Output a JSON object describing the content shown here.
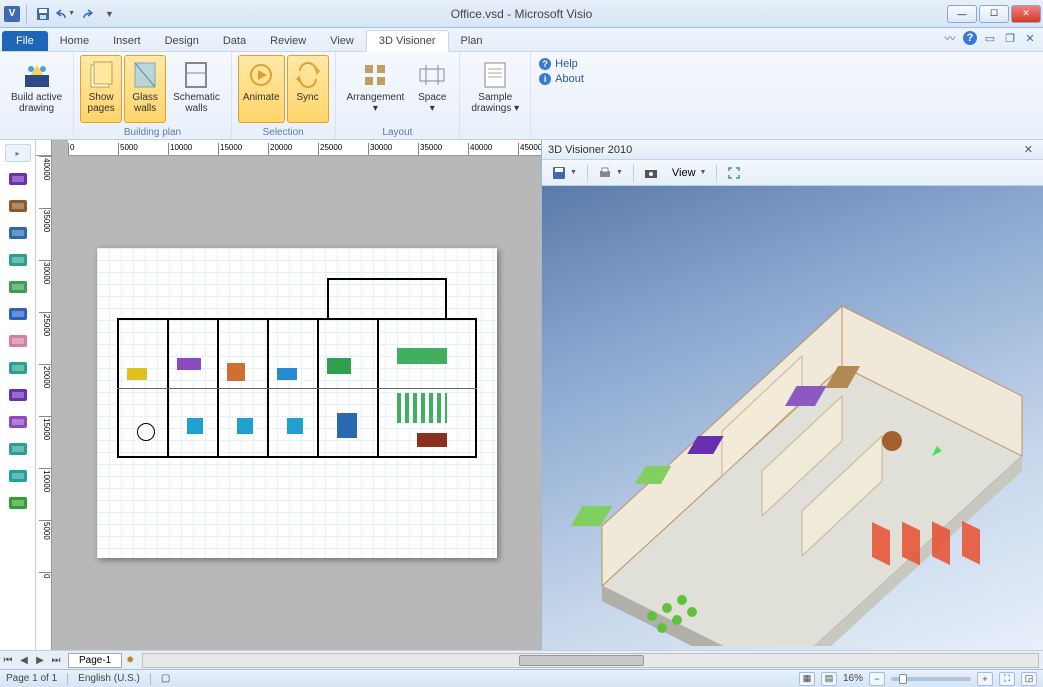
{
  "window": {
    "title": "Office.vsd - Microsoft Visio",
    "app_icon_letter": "V"
  },
  "tabs": {
    "file": "File",
    "items": [
      "Home",
      "Insert",
      "Design",
      "Data",
      "Review",
      "View",
      "3D Visioner",
      "Plan"
    ],
    "active": "3D Visioner"
  },
  "ribbon": {
    "groups": [
      {
        "label": "",
        "buttons": [
          {
            "id": "build-active",
            "label": "Build active\ndrawing",
            "active": false
          }
        ]
      },
      {
        "label": "Building plan",
        "buttons": [
          {
            "id": "show-pages",
            "label": "Show\npages",
            "active": true
          },
          {
            "id": "glass-walls",
            "label": "Glass\nwalls",
            "active": true
          },
          {
            "id": "schematic-walls",
            "label": "Schematic\nwalls",
            "active": false
          }
        ]
      },
      {
        "label": "Selection",
        "buttons": [
          {
            "id": "animate",
            "label": "Animate",
            "active": true
          },
          {
            "id": "sync",
            "label": "Sync",
            "active": true
          }
        ]
      },
      {
        "label": "Layout",
        "buttons": [
          {
            "id": "arrangement",
            "label": "Arrangement\n▾",
            "active": false
          },
          {
            "id": "space",
            "label": "Space\n▾",
            "active": false
          }
        ]
      },
      {
        "label": "",
        "buttons": [
          {
            "id": "sample-drawings",
            "label": "Sample\ndrawings ▾",
            "active": false
          }
        ]
      }
    ],
    "help": {
      "help_label": "Help",
      "about_label": "About"
    }
  },
  "hruler_marks": [
    "0",
    "5000",
    "10000",
    "15000",
    "20000",
    "25000",
    "30000",
    "35000",
    "40000",
    "45000"
  ],
  "vruler_marks": [
    "40000",
    "35000",
    "30000",
    "25000",
    "20000",
    "15000",
    "10000",
    "5000",
    "0"
  ],
  "sheet_tabs": {
    "page_label": "Page-1"
  },
  "viewer": {
    "title": "3D Visioner 2010",
    "toolbar": {
      "view_label": "View"
    }
  },
  "statusbar": {
    "page_info": "Page 1 of 1",
    "language": "English (U.S.)",
    "zoom": "16%"
  },
  "shapes_panel_icons": [
    {
      "name": "desk-purple",
      "fill": "#6a2fb0"
    },
    {
      "name": "chair-brown",
      "fill": "#8a5a2a"
    },
    {
      "name": "table-blue",
      "fill": "#2a6ab0"
    },
    {
      "name": "table-teal",
      "fill": "#2aa090"
    },
    {
      "name": "cabinet-green",
      "fill": "#3aa050"
    },
    {
      "name": "cabinet-blue",
      "fill": "#2a60c0"
    },
    {
      "name": "sofa-pink",
      "fill": "#d080a0"
    },
    {
      "name": "unit-teal",
      "fill": "#2aa090"
    },
    {
      "name": "shelf-purple",
      "fill": "#6a2fb0"
    },
    {
      "name": "plant-purple",
      "fill": "#8a4ac0"
    },
    {
      "name": "plant-teal",
      "fill": "#2aa090"
    },
    {
      "name": "lamp-teal",
      "fill": "#20a0a0"
    },
    {
      "name": "tree-green",
      "fill": "#30a030"
    }
  ]
}
